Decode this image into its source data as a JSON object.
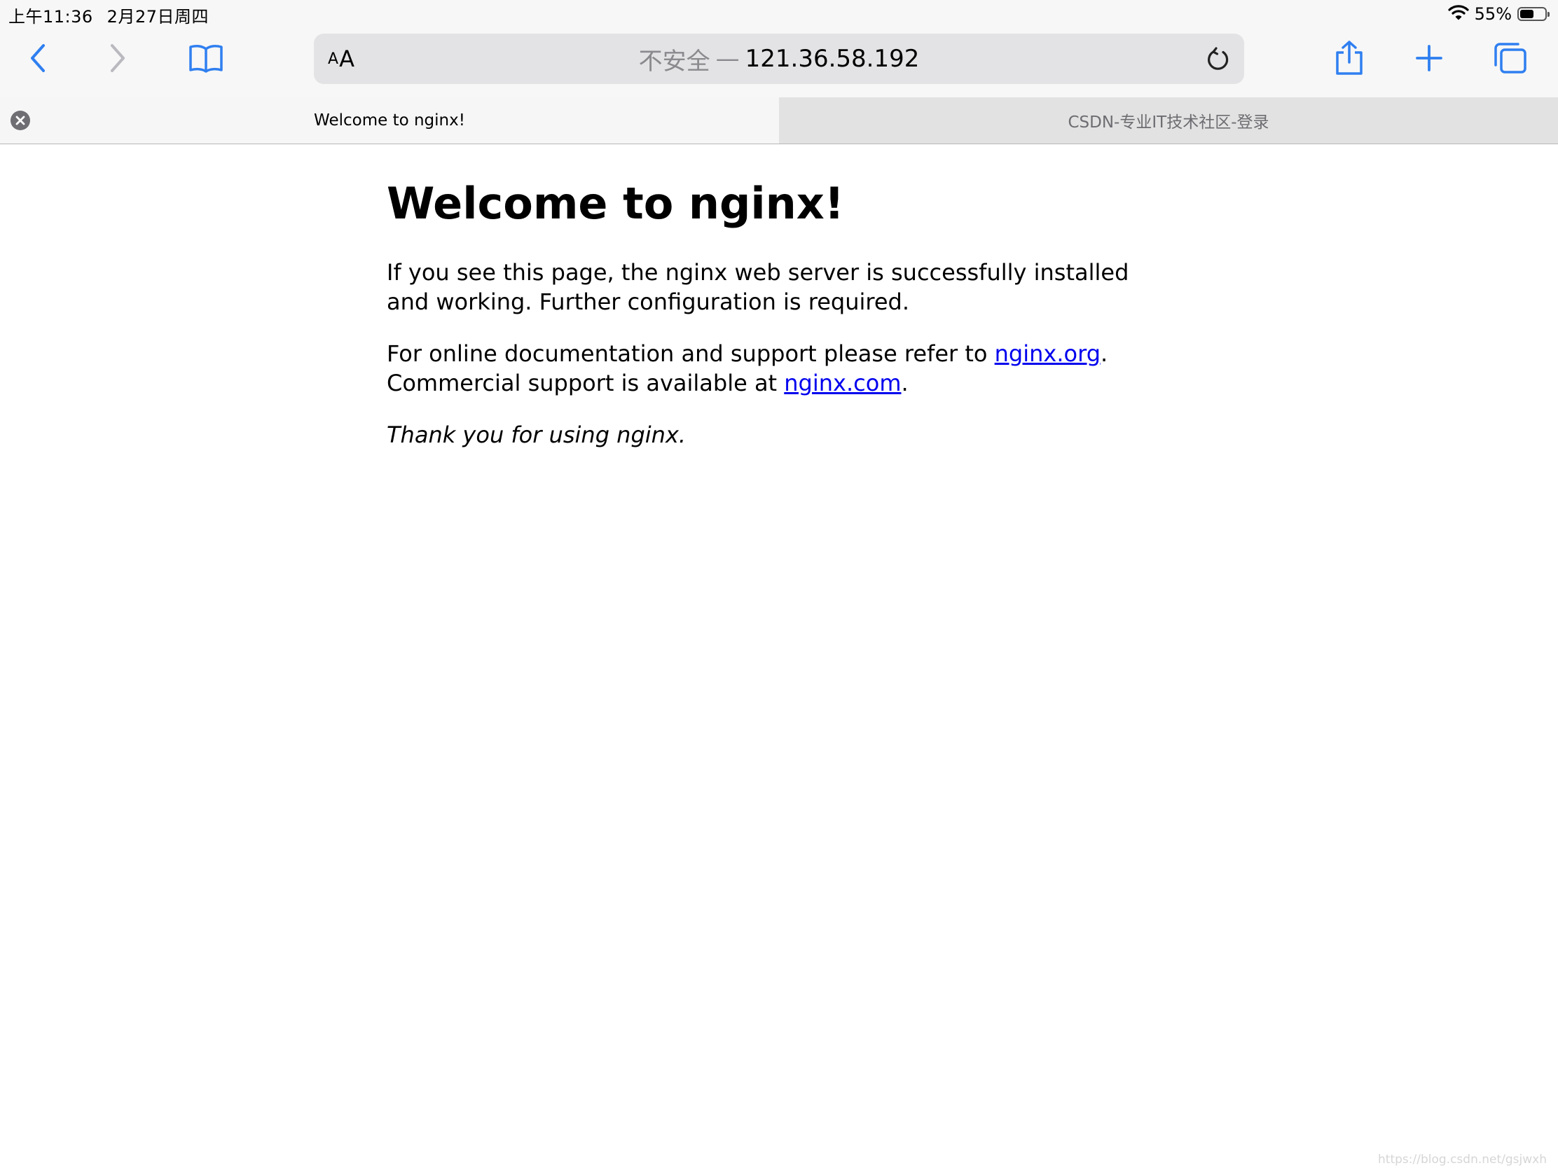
{
  "status_bar": {
    "time": "上午11:36",
    "date": "2月27日周四",
    "battery_percent": "55%",
    "battery_level": 0.55
  },
  "toolbar": {
    "text_size_small": "A",
    "text_size_large": "A",
    "security_label": "不安全",
    "separator": "—",
    "host": "121.36.58.192",
    "accent_color": "#1a73e8"
  },
  "tabs": [
    {
      "title": "Welcome to nginx!",
      "active": true
    },
    {
      "title": "CSDN-专业IT技术社区-登录",
      "active": false
    }
  ],
  "page": {
    "heading": "Welcome to nginx!",
    "p1": "If you see this page, the nginx web server is successfully installed and working. Further configuration is required.",
    "p2_prefix": "For online documentation and support please refer to ",
    "link_org": "nginx.org",
    "p2_mid": ".",
    "p2_line2_prefix": "Commercial support is available at ",
    "link_com": "nginx.com",
    "p2_suffix": ".",
    "p3": "Thank you for using nginx."
  },
  "watermark": "https://blog.csdn.net/gsjwxh"
}
